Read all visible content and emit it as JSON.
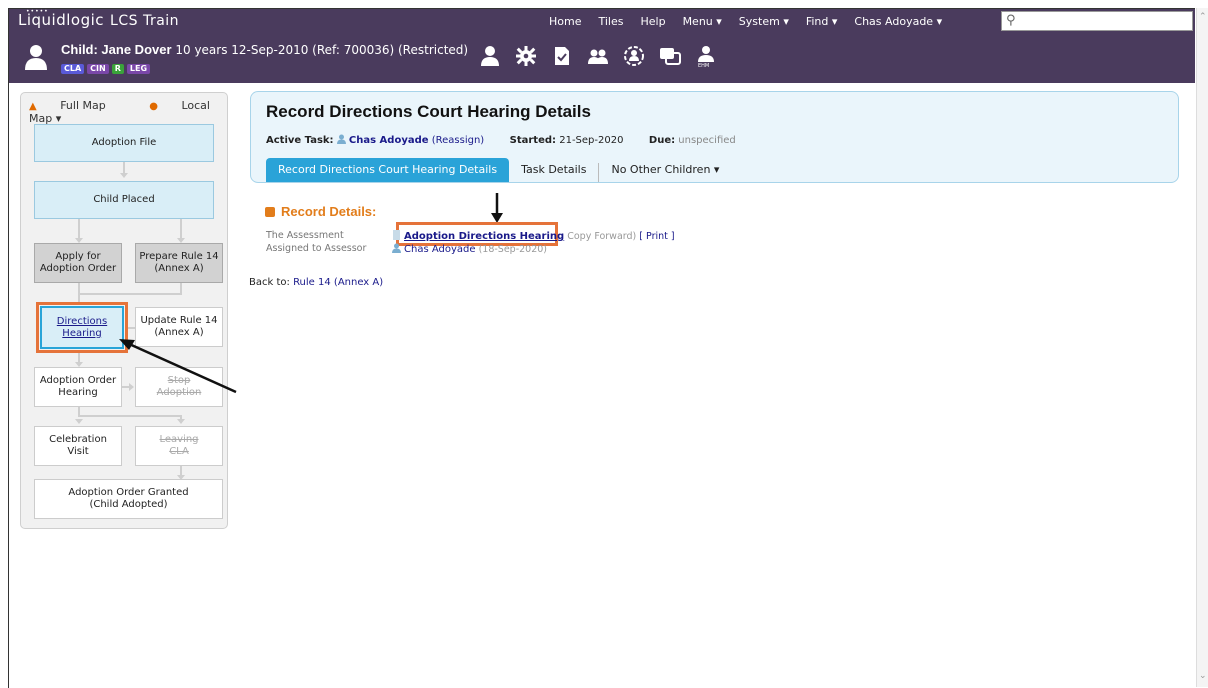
{
  "app": {
    "name": "Liquidlogic",
    "product": "LCS Train"
  },
  "topnav": {
    "items": [
      "Home",
      "Tiles",
      "Help",
      "Menu ▾",
      "System ▾",
      "Find ▾",
      "Chas Adoyade ▾"
    ],
    "search_placeholder": ""
  },
  "child": {
    "name": "Child: Jane Dover",
    "details": "10 years 12-Sep-2010 (Ref: 700036) (Restricted)",
    "badges": [
      "CLA",
      "CIN",
      "R",
      "LEG"
    ],
    "icon_label_ehm": "EHM"
  },
  "map": {
    "full_map": "Full Map",
    "local_map": "Local Map ▾",
    "nodes": {
      "adoption_file": "Adoption File",
      "child_placed": "Child Placed",
      "apply_order_1": "Apply for",
      "apply_order_2": "Adoption Order",
      "prepare_rule14_1": "Prepare Rule 14",
      "prepare_rule14_2": "(Annex A)",
      "directions_1": "Directions",
      "directions_2": "Hearing",
      "update_rule14_1": "Update Rule 14",
      "update_rule14_2": "(Annex A)",
      "order_hearing_1": "Adoption Order",
      "order_hearing_2": "Hearing",
      "stop_adoption_1": "Stop",
      "stop_adoption_2": "Adoption",
      "celebration_1": "Celebration",
      "celebration_2": "Visit",
      "leaving_cla_1": "Leaving",
      "leaving_cla_2": "CLA",
      "order_granted_1": "Adoption Order Granted",
      "order_granted_2": "(Child Adopted)"
    }
  },
  "page": {
    "title": "Record Directions Court Hearing Details",
    "active_task_label": "Active Task:",
    "active_task_user": "Chas Adoyade",
    "reassign": "(Reassign)",
    "started_label": "Started:",
    "started_value": "21-Sep-2020",
    "due_label": "Due:",
    "due_value": "unspecified",
    "tabs": [
      "Record Directions Court Hearing Details",
      "Task Details",
      "No Other Children ▾"
    ]
  },
  "record_details": {
    "heading": "Record Details:",
    "assessment_label": "The Assessment",
    "assessment_link": "Adoption Directions Hearing",
    "copy_forward": "Copy Forward)",
    "print": "[ Print ]",
    "assessor_label": "Assigned to Assessor",
    "assessor_name": "Chas Adoyade",
    "assessor_date": "(18-Sep-2020)"
  },
  "back_to": {
    "label": "Back to:",
    "link": "Rule 14 (Annex A)"
  },
  "colors": {
    "header": "#4a3b5d",
    "accent": "#2aa3d8",
    "orange": "#e27d1b",
    "highlight": "#e5733a"
  }
}
